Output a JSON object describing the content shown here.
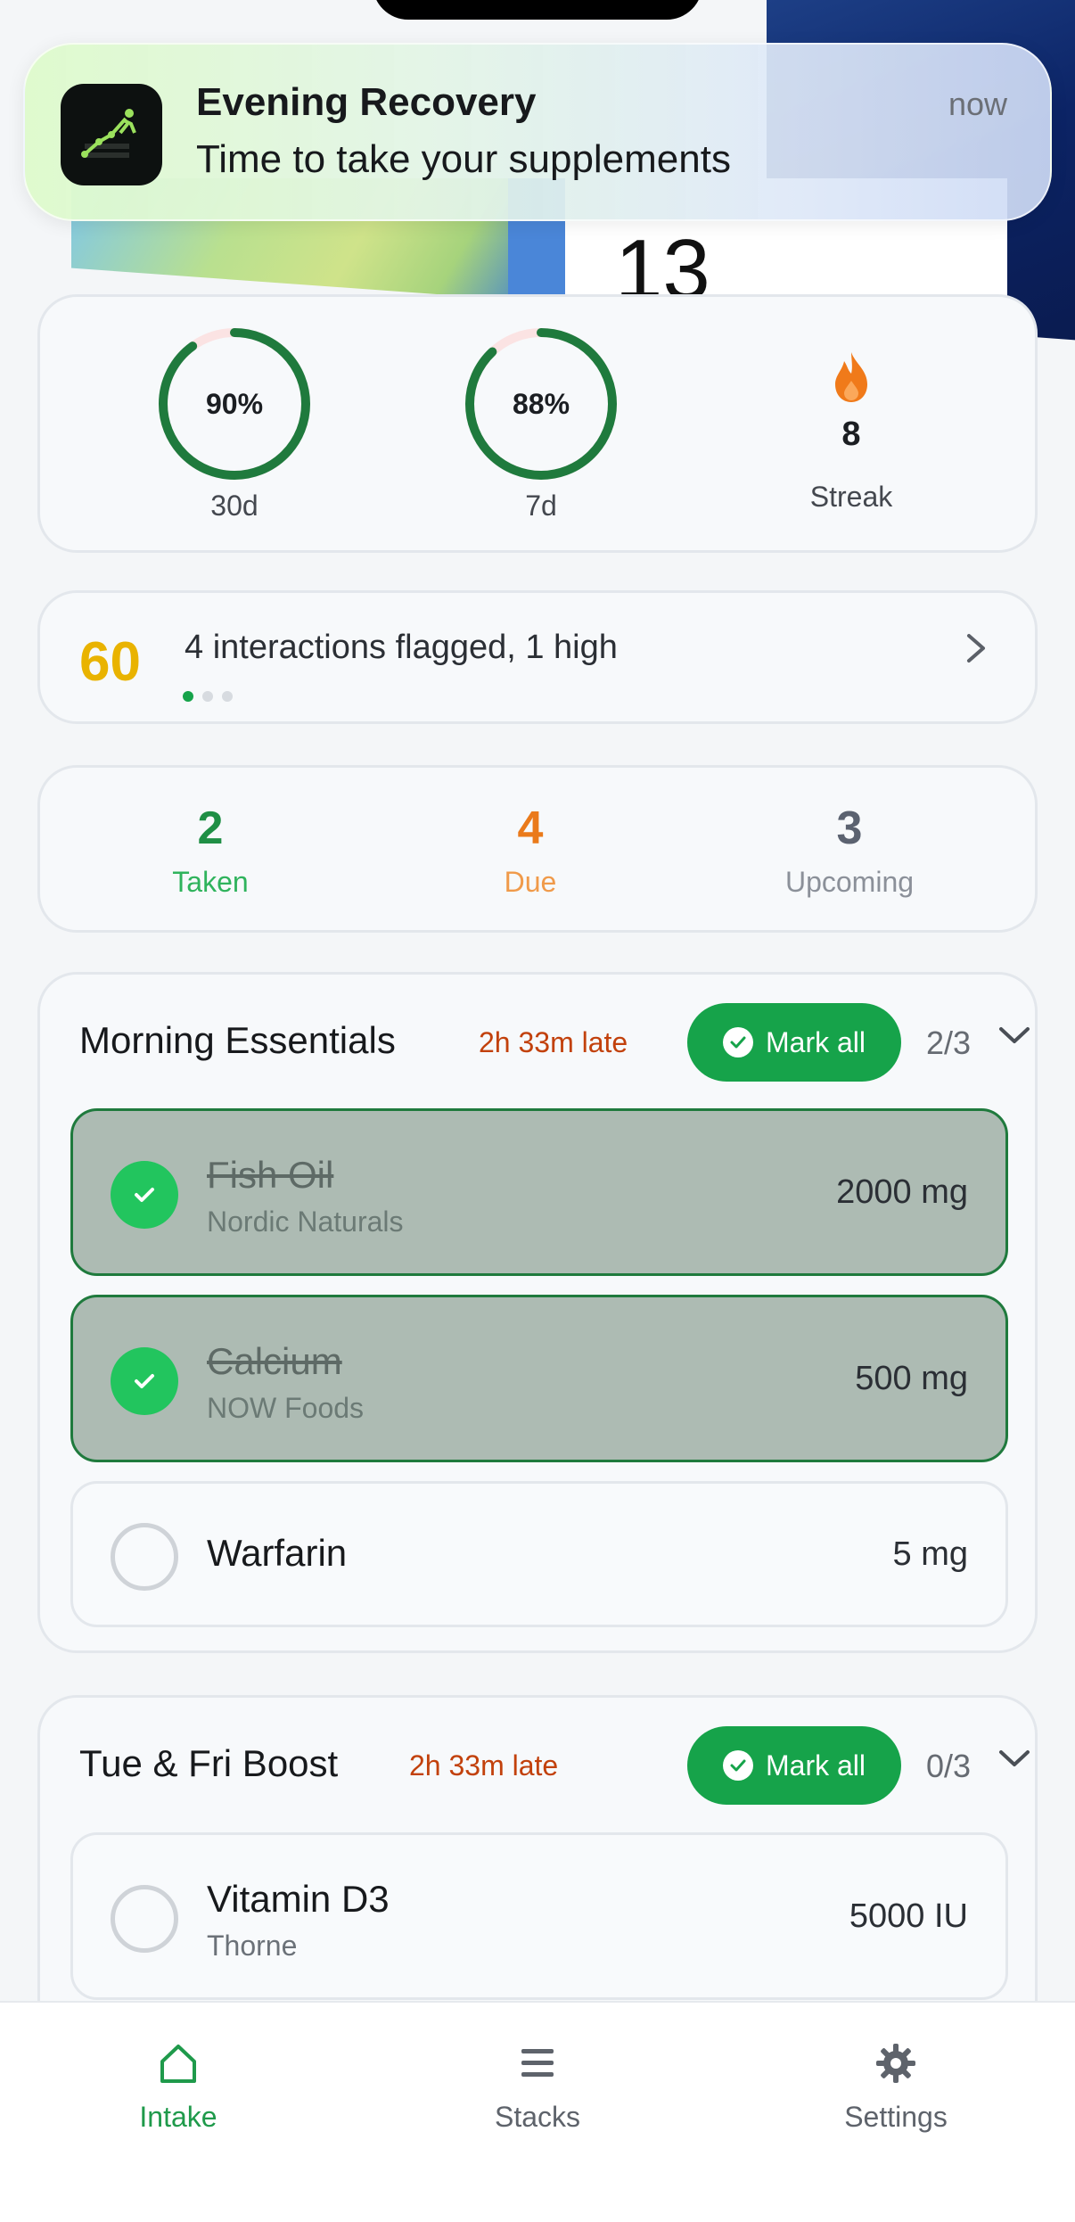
{
  "notification": {
    "app_icon": "runner-chart-icon",
    "title": "Evening Recovery",
    "body": "Time to take your supplements",
    "time": "now"
  },
  "background_peek": {
    "number": "13"
  },
  "stats": {
    "rings": [
      {
        "value": 0.9,
        "text": "90%",
        "label": "30d"
      },
      {
        "value": 0.88,
        "text": "88%",
        "label": "7d"
      }
    ],
    "streak": {
      "icon": "flame-icon",
      "value": "8",
      "label": "Streak"
    }
  },
  "score": {
    "value": "60",
    "text": "4 interactions flagged, 1 high",
    "chevron": "chevron-right-icon"
  },
  "summary": {
    "taken": {
      "value": "2",
      "label": "Taken"
    },
    "due": {
      "value": "4",
      "label": "Due"
    },
    "upcoming": {
      "value": "3",
      "label": "Upcoming"
    }
  },
  "stacks": [
    {
      "title": "Morning Essentials",
      "late": "2h 33m late",
      "mark_all": "Mark all",
      "count": "2/3",
      "items": [
        {
          "name": "Fish Oil",
          "brand": "Nordic Naturals",
          "dose": "2000 mg",
          "done": true
        },
        {
          "name": "Calcium",
          "brand": "NOW Foods",
          "dose": "500 mg",
          "done": true
        },
        {
          "name": "Warfarin",
          "brand": "",
          "dose": "5 mg",
          "done": false
        }
      ]
    },
    {
      "title": "Tue & Fri Boost",
      "late": "2h 33m late",
      "mark_all": "Mark all",
      "count": "0/3",
      "items": [
        {
          "name": "Vitamin D3",
          "brand": "Thorne",
          "dose": "5000 IU",
          "done": false
        }
      ]
    }
  ],
  "nav": [
    {
      "label": "Intake",
      "icon": "home-icon",
      "active": true
    },
    {
      "label": "Stacks",
      "icon": "list-icon",
      "active": false
    },
    {
      "label": "Settings",
      "icon": "gear-icon",
      "active": false
    }
  ],
  "colors": {
    "accent": "#16a34a",
    "warning": "#c2410c",
    "due": "#ea7a1a",
    "score": "#e9b300"
  }
}
